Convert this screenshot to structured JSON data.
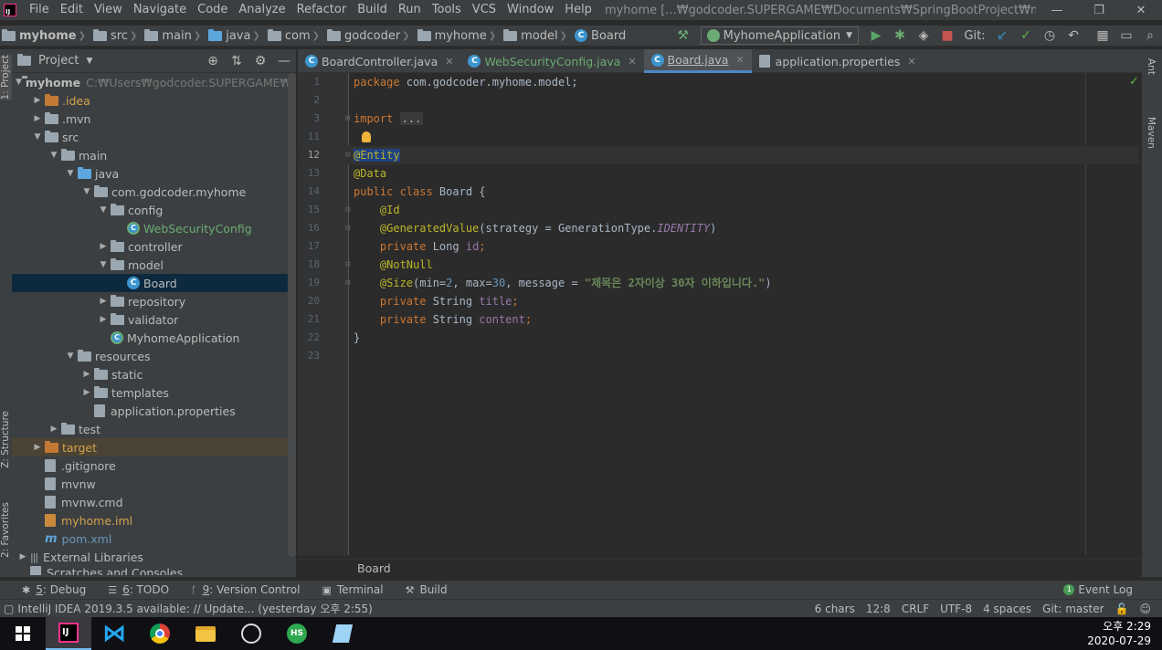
{
  "window": {
    "title": "myhome [...₩godcoder.SUPERGAME₩Documents₩SpringBootProject₩myhome] - ...₩Board.java",
    "menu": [
      "File",
      "Edit",
      "View",
      "Navigate",
      "Code",
      "Analyze",
      "Refactor",
      "Build",
      "Run",
      "Tools",
      "VCS",
      "Window",
      "Help"
    ],
    "controls": {
      "minimize": "—",
      "restore": "❐",
      "close": "✕"
    }
  },
  "navbar": {
    "crumbs": [
      "myhome",
      "src",
      "main",
      "java",
      "com",
      "godcoder",
      "myhome",
      "model",
      "Board"
    ],
    "run_config": "MyhomeApplication",
    "git_label": "Git:"
  },
  "left_strip": {
    "project_tab": "1: Project",
    "structure_tab": "Z: Structure",
    "favorites_tab": "2: Favorites"
  },
  "project_panel": {
    "title": "Project",
    "tree": [
      {
        "label": "myhome",
        "hint": "C:₩Users₩godcoder.SUPERGAME₩Doc",
        "bold": true
      },
      {
        "label": ".idea"
      },
      {
        "label": ".mvn"
      },
      {
        "label": "src"
      },
      {
        "label": "main"
      },
      {
        "label": "java"
      },
      {
        "label": "com.godcoder.myhome"
      },
      {
        "label": "config"
      },
      {
        "label": "WebSecurityConfig"
      },
      {
        "label": "controller"
      },
      {
        "label": "model"
      },
      {
        "label": "Board"
      },
      {
        "label": "repository"
      },
      {
        "label": "validator"
      },
      {
        "label": "MyhomeApplication"
      },
      {
        "label": "resources"
      },
      {
        "label": "static"
      },
      {
        "label": "templates"
      },
      {
        "label": "application.properties"
      },
      {
        "label": "test"
      },
      {
        "label": "target"
      },
      {
        "label": ".gitignore"
      },
      {
        "label": "mvnw"
      },
      {
        "label": "mvnw.cmd"
      },
      {
        "label": "myhome.iml"
      },
      {
        "label": "pom.xml"
      },
      {
        "label": "External Libraries"
      },
      {
        "label": "Scratches and Consoles"
      }
    ]
  },
  "tabs": [
    {
      "label": "BoardController.java"
    },
    {
      "label": "WebSecurityConfig.java"
    },
    {
      "label": "Board.java"
    },
    {
      "label": "application.properties"
    }
  ],
  "editor": {
    "line_numbers": [
      "1",
      "2",
      "3",
      "11",
      "12",
      "13",
      "14",
      "15",
      "16",
      "17",
      "18",
      "19",
      "20",
      "21",
      "22",
      "23"
    ],
    "code": {
      "l1_kw": "package",
      "l1_rest": " com.godcoder.myhome.model;",
      "l3_kw": "import",
      "l3_fold": "...",
      "l12": "@Entity",
      "l13": "@Data",
      "l14_kw": "public class",
      "l14_rest": " Board {",
      "l15": "@Id",
      "l16_ann": "@GeneratedValue",
      "l16_rest": "(strategy = GenerationType.",
      "l16_field": "IDENTITY",
      "l16_end": ")",
      "l17_kw": "private",
      "l17_type": " Long ",
      "l17_field": "id",
      "l17_end": ";",
      "l18": "@NotNull",
      "l19_ann": "@Size",
      "l19_a": "(min=",
      "l19_n1": "2",
      "l19_b": ", max=",
      "l19_n2": "30",
      "l19_c": ", message = ",
      "l19_str": "\"제목은 2자이상 30자 이하입니다.\"",
      "l19_end": ")",
      "l20_kw": "private",
      "l20_type": " String ",
      "l20_field": "title",
      "l20_end": ";",
      "l21_kw": "private",
      "l21_type": " String ",
      "l21_field": "content",
      "l21_end": ";",
      "l22": "}"
    },
    "breadcrumb": "Board"
  },
  "right_strip": {
    "ant": "Ant",
    "maven": "Maven"
  },
  "bottom_tools": [
    {
      "num": "5",
      "label": ": Debug"
    },
    {
      "num": "6",
      "label": ": TODO"
    },
    {
      "num": "9",
      "label": ": Version Control"
    },
    {
      "num": "",
      "label": "Terminal"
    },
    {
      "num": "",
      "label": "Build"
    }
  ],
  "event_log": {
    "label": "Event Log",
    "count": "1"
  },
  "status": {
    "message": "IntelliJ IDEA 2019.3.5 available: // Update... (yesterday 오후 2:55)",
    "chars": "6 chars",
    "position": "12:8",
    "line_sep": "CRLF",
    "encoding": "UTF-8",
    "indent": "4 spaces",
    "branch": "Git: master"
  },
  "taskbar": {
    "time": "오후 2:29",
    "date": "2020-07-29",
    "hs_label": "HS"
  }
}
